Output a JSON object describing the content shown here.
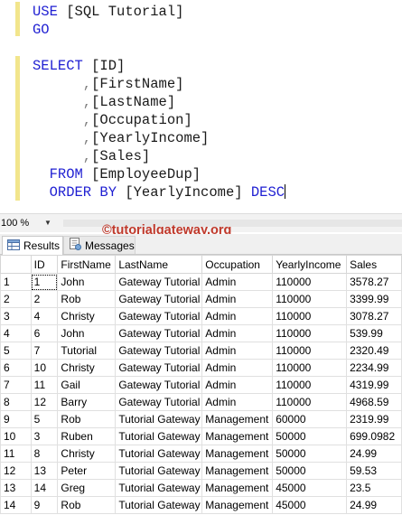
{
  "editor": {
    "lines": [
      {
        "parts": [
          {
            "t": "USE ",
            "c": "kw"
          },
          {
            "t": "[SQL Tutorial]",
            "c": "tx"
          }
        ]
      },
      {
        "parts": [
          {
            "t": "GO",
            "c": "kw"
          }
        ]
      },
      {
        "parts": []
      },
      {
        "parts": [
          {
            "t": "SELECT ",
            "c": "kw"
          },
          {
            "t": "[ID]",
            "c": "tx"
          }
        ]
      },
      {
        "parts": [
          {
            "t": "      ,",
            "c": "punct"
          },
          {
            "t": "[FirstName]",
            "c": "tx"
          }
        ]
      },
      {
        "parts": [
          {
            "t": "      ,",
            "c": "punct"
          },
          {
            "t": "[LastName]",
            "c": "tx"
          }
        ]
      },
      {
        "parts": [
          {
            "t": "      ,",
            "c": "punct"
          },
          {
            "t": "[Occupation]",
            "c": "tx"
          }
        ]
      },
      {
        "parts": [
          {
            "t": "      ,",
            "c": "punct"
          },
          {
            "t": "[YearlyIncome]",
            "c": "tx"
          }
        ]
      },
      {
        "parts": [
          {
            "t": "      ,",
            "c": "punct"
          },
          {
            "t": "[Sales]",
            "c": "tx"
          }
        ]
      },
      {
        "parts": [
          {
            "t": "  FROM ",
            "c": "kw"
          },
          {
            "t": "[EmployeeDup]",
            "c": "tx"
          }
        ]
      },
      {
        "parts": [
          {
            "t": "  ORDER BY ",
            "c": "kw"
          },
          {
            "t": "[YearlyIncome] ",
            "c": "tx"
          },
          {
            "t": "DESC",
            "c": "kw"
          }
        ],
        "caret": true
      }
    ]
  },
  "zoom": {
    "value": "100 %"
  },
  "watermark": "©tutorialgateway.org",
  "tabs": [
    {
      "label": "Results",
      "icon": "results-grid-icon",
      "active": true
    },
    {
      "label": "Messages",
      "icon": "messages-icon",
      "active": false
    }
  ],
  "grid": {
    "columns": [
      "",
      "ID",
      "FirstName",
      "LastName",
      "Occupation",
      "YearlyIncome",
      "Sales"
    ],
    "rows": [
      [
        "1",
        "1",
        "John",
        "Gateway Tutorial",
        "Admin",
        "110000",
        "3578.27"
      ],
      [
        "2",
        "2",
        "Rob",
        "Gateway Tutorial",
        "Admin",
        "110000",
        "3399.99"
      ],
      [
        "3",
        "4",
        "Christy",
        "Gateway Tutorial",
        "Admin",
        "110000",
        "3078.27"
      ],
      [
        "4",
        "6",
        "John",
        "Gateway Tutorial",
        "Admin",
        "110000",
        "539.99"
      ],
      [
        "5",
        "7",
        "Tutorial",
        "Gateway Tutorial",
        "Admin",
        "110000",
        "2320.49"
      ],
      [
        "6",
        "10",
        "Christy",
        "Gateway Tutorial",
        "Admin",
        "110000",
        "2234.99"
      ],
      [
        "7",
        "11",
        "Gail",
        "Gateway Tutorial",
        "Admin",
        "110000",
        "4319.99"
      ],
      [
        "8",
        "12",
        "Barry",
        "Gateway Tutorial",
        "Admin",
        "110000",
        "4968.59"
      ],
      [
        "9",
        "5",
        "Rob",
        "Tutorial Gateway",
        "Management",
        "60000",
        "2319.99"
      ],
      [
        "10",
        "3",
        "Ruben",
        "Tutorial Gateway",
        "Management",
        "50000",
        "699.0982"
      ],
      [
        "11",
        "8",
        "Christy",
        "Tutorial Gateway",
        "Management",
        "50000",
        "24.99"
      ],
      [
        "12",
        "13",
        "Peter",
        "Tutorial Gateway",
        "Management",
        "50000",
        "59.53"
      ],
      [
        "13",
        "14",
        "Greg",
        "Tutorial Gateway",
        "Management",
        "45000",
        "23.5"
      ],
      [
        "14",
        "9",
        "Rob",
        "Tutorial Gateway",
        "Management",
        "45000",
        "24.99"
      ]
    ]
  }
}
